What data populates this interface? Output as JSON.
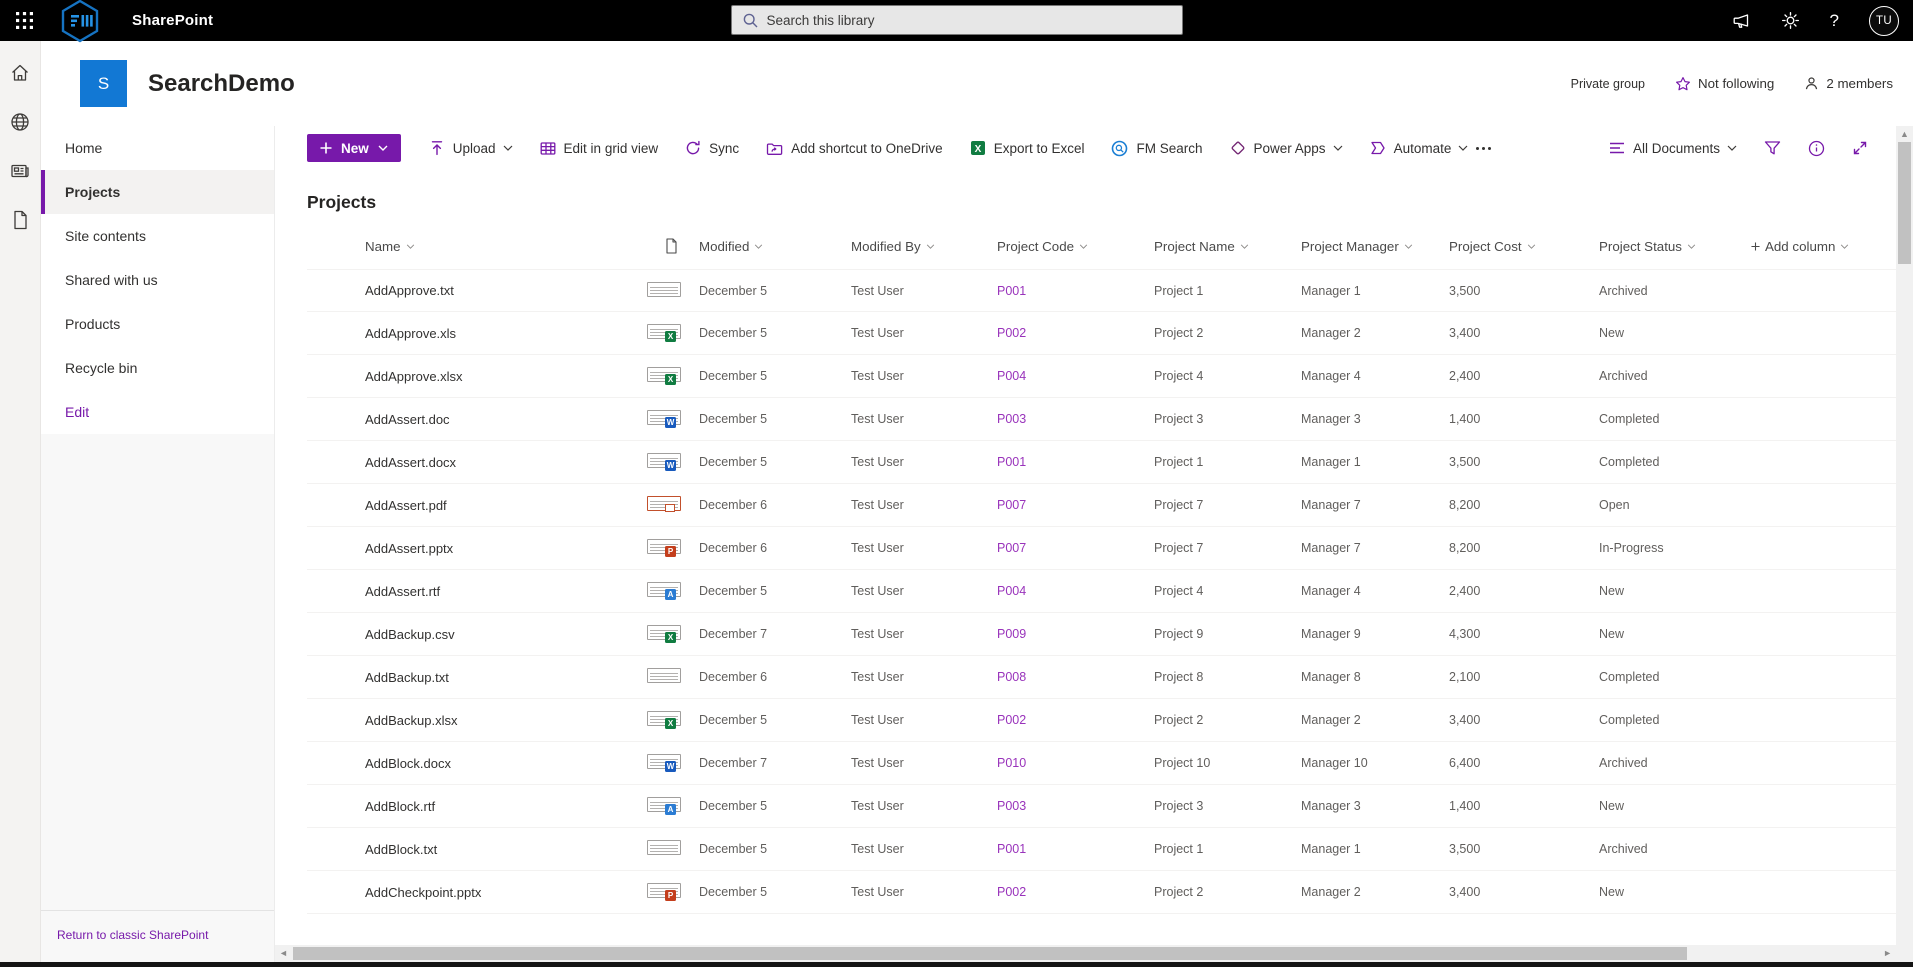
{
  "colors": {
    "accent": "#7719aa",
    "site_logo_blue": "#1278d4",
    "project_code_link": "#9933bb",
    "excel_green": "#107c41",
    "word_blue": "#185abd",
    "powerpoint_orange": "#c43e1c",
    "pdf_orange": "#c2502c",
    "rtf_blue": "#2b7cd3",
    "fm_search_blue": "#1b7fd4",
    "suite_bar_black": "#000000"
  },
  "suite_bar": {
    "app_name": "SharePoint",
    "search_placeholder": "Search this library",
    "avatar_initials": "TU",
    "icons": [
      "app-launcher-icon",
      "org-logo-hexagon",
      "megaphone-icon",
      "gear-icon",
      "help-icon"
    ]
  },
  "left_rail": {
    "icons": [
      "home-icon",
      "globe-icon",
      "news-icon",
      "document-icon"
    ]
  },
  "site_header": {
    "site_initial": "S",
    "site_name": "SearchDemo",
    "privacy_label": "Private group",
    "follow_label": "Not following",
    "members_label": "2 members"
  },
  "sidebar": {
    "items": [
      {
        "label": "Home",
        "state": "default"
      },
      {
        "label": "Projects",
        "state": "selected"
      },
      {
        "label": "Site contents",
        "state": "default"
      },
      {
        "label": "Shared with us",
        "state": "default"
      },
      {
        "label": "Products",
        "state": "default"
      },
      {
        "label": "Recycle bin",
        "state": "default"
      },
      {
        "label": "Edit",
        "state": "link"
      }
    ],
    "classic_link": "Return to classic SharePoint"
  },
  "toolbar": {
    "new_label": "New",
    "items": [
      {
        "label": "Upload",
        "icon": "upload",
        "chevron": true
      },
      {
        "label": "Edit in grid view",
        "icon": "grid",
        "chevron": false
      },
      {
        "label": "Sync",
        "icon": "sync",
        "chevron": false
      },
      {
        "label": "Add shortcut to OneDrive",
        "icon": "shortcut",
        "chevron": false
      },
      {
        "label": "Export to Excel",
        "icon": "excel",
        "chevron": false
      },
      {
        "label": "FM Search",
        "icon": "fmsearch",
        "chevron": false
      },
      {
        "label": "Power Apps",
        "icon": "powerapps",
        "chevron": true
      },
      {
        "label": "Automate",
        "icon": "automate",
        "chevron": true
      }
    ],
    "view_label": "All Documents"
  },
  "main": {
    "title": "Projects",
    "table": {
      "columns": [
        "Name",
        "Modified",
        "Modified By",
        "Project Code",
        "Project Name",
        "Project Manager",
        "Project Cost",
        "Project Status"
      ],
      "add_column_label": "Add column",
      "rows": [
        {
          "name": "AddApprove.txt",
          "type": "txt",
          "modified": "December 5",
          "modified_by": "Test User",
          "code": "P001",
          "project": "Project 1",
          "manager": "Manager 1",
          "cost": "3,500",
          "status": "Archived"
        },
        {
          "name": "AddApprove.xls",
          "type": "xls",
          "modified": "December 5",
          "modified_by": "Test User",
          "code": "P002",
          "project": "Project 2",
          "manager": "Manager 2",
          "cost": "3,400",
          "status": "New"
        },
        {
          "name": "AddApprove.xlsx",
          "type": "xls",
          "modified": "December 5",
          "modified_by": "Test User",
          "code": "P004",
          "project": "Project 4",
          "manager": "Manager 4",
          "cost": "2,400",
          "status": "Archived"
        },
        {
          "name": "AddAssert.doc",
          "type": "doc",
          "modified": "December 5",
          "modified_by": "Test User",
          "code": "P003",
          "project": "Project 3",
          "manager": "Manager 3",
          "cost": "1,400",
          "status": "Completed"
        },
        {
          "name": "AddAssert.docx",
          "type": "doc",
          "modified": "December 5",
          "modified_by": "Test User",
          "code": "P001",
          "project": "Project 1",
          "manager": "Manager 1",
          "cost": "3,500",
          "status": "Completed"
        },
        {
          "name": "AddAssert.pdf",
          "type": "pdf",
          "modified": "December 6",
          "modified_by": "Test User",
          "code": "P007",
          "project": "Project 7",
          "manager": "Manager 7",
          "cost": "8,200",
          "status": "Open"
        },
        {
          "name": "AddAssert.pptx",
          "type": "ppt",
          "modified": "December 6",
          "modified_by": "Test User",
          "code": "P007",
          "project": "Project 7",
          "manager": "Manager 7",
          "cost": "8,200",
          "status": "In-Progress"
        },
        {
          "name": "AddAssert.rtf",
          "type": "rtf",
          "modified": "December 5",
          "modified_by": "Test User",
          "code": "P004",
          "project": "Project 4",
          "manager": "Manager 4",
          "cost": "2,400",
          "status": "New"
        },
        {
          "name": "AddBackup.csv",
          "type": "csv",
          "modified": "December 7",
          "modified_by": "Test User",
          "code": "P009",
          "project": "Project 9",
          "manager": "Manager 9",
          "cost": "4,300",
          "status": "New"
        },
        {
          "name": "AddBackup.txt",
          "type": "txt",
          "modified": "December 6",
          "modified_by": "Test User",
          "code": "P008",
          "project": "Project 8",
          "manager": "Manager 8",
          "cost": "2,100",
          "status": "Completed"
        },
        {
          "name": "AddBackup.xlsx",
          "type": "xls",
          "modified": "December 5",
          "modified_by": "Test User",
          "code": "P002",
          "project": "Project 2",
          "manager": "Manager 2",
          "cost": "3,400",
          "status": "Completed"
        },
        {
          "name": "AddBlock.docx",
          "type": "doc",
          "modified": "December 7",
          "modified_by": "Test User",
          "code": "P010",
          "project": "Project 10",
          "manager": "Manager 10",
          "cost": "6,400",
          "status": "Archived"
        },
        {
          "name": "AddBlock.rtf",
          "type": "rtf",
          "modified": "December 5",
          "modified_by": "Test User",
          "code": "P003",
          "project": "Project 3",
          "manager": "Manager 3",
          "cost": "1,400",
          "status": "New"
        },
        {
          "name": "AddBlock.txt",
          "type": "txt",
          "modified": "December 5",
          "modified_by": "Test User",
          "code": "P001",
          "project": "Project 1",
          "manager": "Manager 1",
          "cost": "3,500",
          "status": "Archived"
        },
        {
          "name": "AddCheckpoint.pptx",
          "type": "ppt",
          "modified": "December 5",
          "modified_by": "Test User",
          "code": "P002",
          "project": "Project 2",
          "manager": "Manager 2",
          "cost": "3,400",
          "status": "New"
        }
      ]
    }
  }
}
